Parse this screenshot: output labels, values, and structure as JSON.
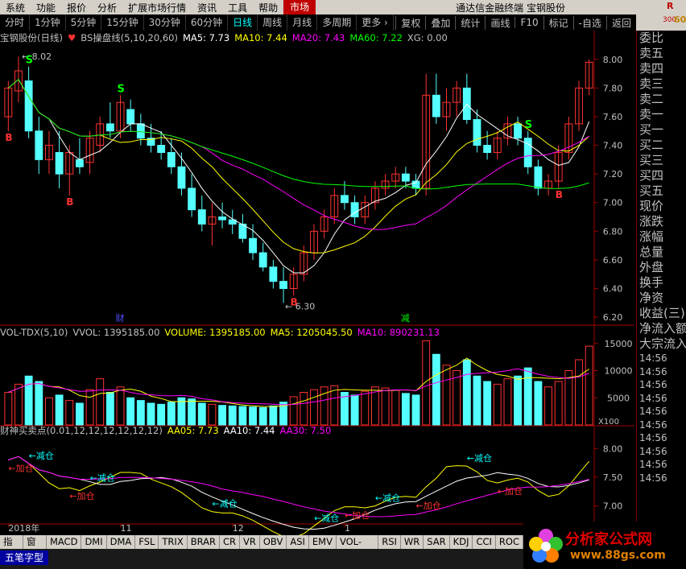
{
  "menu": [
    "系统",
    "功能",
    "报价",
    "分析",
    "扩展市场行情",
    "资讯",
    "工具",
    "帮助"
  ],
  "menu_market": "市场",
  "window_title": "通达信金融终端  宝钢股份",
  "menu_right": [
    "行情"
  ],
  "corner": {
    "r": "R",
    "n": "300",
    "val": "60"
  },
  "toolbar": {
    "periods": [
      "分时",
      "1分钟",
      "5分钟",
      "15分钟",
      "30分钟",
      "60分钟",
      "日线",
      "周线",
      "月线",
      "多周期",
      "更多"
    ],
    "active_period": "日线",
    "more_arrow": "›",
    "right": [
      "复权",
      "叠加",
      "统计",
      "画线",
      "F10",
      "标记",
      "-自选",
      "返回"
    ]
  },
  "price_panel": {
    "stock": "宝钢股份(日线)",
    "indicator": "BS操盘线(5,10,20,60)",
    "ma5": "MA5: 7.73",
    "ma10": "MA10: 7.44",
    "ma20": "MA20: 7.43",
    "ma60": "MA60: 7.22",
    "xg": "XG: 0.00",
    "y_ticks": [
      "8.00",
      "7.80",
      "7.60",
      "7.40",
      "7.20",
      "7.00",
      "6.80",
      "6.60",
      "6.40",
      "6.20"
    ],
    "high_label": "8.02",
    "low_label": "6.30",
    "signals": [
      "S",
      "S",
      "S",
      "B",
      "B",
      "B",
      "B"
    ],
    "events": [
      "财",
      "减"
    ]
  },
  "volume_panel": {
    "title": "VOL-TDX(5,10)",
    "vvol": "VVOL: 1395185.00",
    "volume": "VOLUME: 1395185.00",
    "ma5": "MA5: 1205045.50",
    "ma10": "MA10: 890231.13",
    "y_ticks": [
      "15000",
      "10000",
      "5000"
    ],
    "unit": "X100"
  },
  "ind_panel": {
    "title": "财神买卖点(0.01,12,12,12,12,12,12)",
    "aa05": "AA05: 7.73",
    "aa10": "AA10: 7.44",
    "aa30": "AA30: 7.50",
    "y_ticks": [
      "8.00",
      "7.50",
      "7.00"
    ],
    "labels": [
      "←减仓",
      "←减仓",
      "←减仓",
      "←减仓",
      "←减仓",
      "←减仓",
      "←加仓",
      "←加仓",
      "←加仓",
      "←加仓",
      "←加仓",
      "←加仓"
    ]
  },
  "x_axis": [
    "2018年",
    "11",
    "12",
    "1"
  ],
  "sidebar": {
    "items": [
      "委比",
      "卖五",
      "卖四",
      "卖三",
      "卖二",
      "卖一",
      "买一",
      "买二",
      "买三",
      "买四",
      "买五",
      "现价",
      "涨跌",
      "涨幅",
      "总量",
      "外盘",
      "换手",
      "净资",
      "收益(三)",
      "净流入额",
      "大宗流入"
    ],
    "times": [
      "14:56",
      "14:56",
      "14:56",
      "14:56",
      "14:56",
      "14:56",
      "14:56",
      "14:56",
      "14:56",
      "14:56"
    ]
  },
  "bottom_tabs": [
    "指标",
    "窗口",
    "MACD",
    "DMI",
    "DMA",
    "FSL",
    "TRIX",
    "BRAR",
    "CR",
    "VR",
    "OBV",
    "ASI",
    "EMV",
    "VOL-TDX",
    "RSI",
    "WR",
    "SAR",
    "KDJ",
    "CCI",
    "ROC"
  ],
  "ime": "五笔字型",
  "logo": {
    "text": "分析家公式网",
    "url": "www.88gs.com"
  },
  "colors": {
    "up": "#ff3232",
    "down": "#54ffff",
    "ma5": "#ffffff",
    "ma10": "#ffff00",
    "ma20": "#ff00ff",
    "ma60": "#00ff00"
  },
  "chart_data": {
    "type": "candlestick",
    "title": "BS操盘线(5,10,20,60)",
    "ylim": [
      6.15,
      8.1
    ],
    "candles": [
      [
        7.6,
        7.85,
        7.5,
        7.8
      ],
      [
        7.78,
        8.02,
        7.7,
        7.92
      ],
      [
        7.85,
        7.95,
        7.45,
        7.5
      ],
      [
        7.5,
        7.6,
        7.2,
        7.3
      ],
      [
        7.3,
        7.5,
        7.2,
        7.4
      ],
      [
        7.35,
        7.5,
        7.1,
        7.2
      ],
      [
        7.2,
        7.4,
        7.05,
        7.35
      ],
      [
        7.3,
        7.45,
        7.2,
        7.25
      ],
      [
        7.28,
        7.5,
        7.2,
        7.45
      ],
      [
        7.4,
        7.6,
        7.35,
        7.55
      ],
      [
        7.55,
        7.7,
        7.45,
        7.5
      ],
      [
        7.5,
        7.75,
        7.45,
        7.7
      ],
      [
        7.65,
        7.72,
        7.5,
        7.55
      ],
      [
        7.55,
        7.62,
        7.4,
        7.45
      ],
      [
        7.45,
        7.55,
        7.35,
        7.4
      ],
      [
        7.4,
        7.5,
        7.3,
        7.35
      ],
      [
        7.35,
        7.45,
        7.2,
        7.25
      ],
      [
        7.25,
        7.35,
        7.05,
        7.1
      ],
      [
        7.1,
        7.2,
        6.9,
        6.95
      ],
      [
        6.95,
        7.05,
        6.8,
        6.85
      ],
      [
        6.85,
        7.0,
        6.7,
        6.9
      ],
      [
        6.9,
        7.0,
        6.82,
        6.88
      ],
      [
        6.88,
        6.95,
        6.78,
        6.85
      ],
      [
        6.85,
        6.92,
        6.72,
        6.75
      ],
      [
        6.75,
        6.85,
        6.6,
        6.65
      ],
      [
        6.65,
        6.72,
        6.52,
        6.55
      ],
      [
        6.55,
        6.6,
        6.4,
        6.45
      ],
      [
        6.45,
        6.55,
        6.3,
        6.4
      ],
      [
        6.4,
        6.55,
        6.35,
        6.5
      ],
      [
        6.5,
        6.7,
        6.45,
        6.65
      ],
      [
        6.65,
        6.85,
        6.6,
        6.8
      ],
      [
        6.8,
        6.95,
        6.75,
        6.9
      ],
      [
        6.9,
        7.1,
        6.85,
        7.05
      ],
      [
        7.05,
        7.15,
        6.95,
        7.0
      ],
      [
        7.0,
        7.05,
        6.85,
        6.9
      ],
      [
        6.9,
        7.05,
        6.85,
        7.0
      ],
      [
        7.0,
        7.15,
        6.95,
        7.1
      ],
      [
        7.1,
        7.2,
        7.05,
        7.15
      ],
      [
        7.15,
        7.25,
        7.1,
        7.2
      ],
      [
        7.2,
        7.25,
        7.1,
        7.15
      ],
      [
        7.15,
        7.2,
        7.05,
        7.1
      ],
      [
        7.1,
        7.9,
        7.05,
        7.75
      ],
      [
        7.75,
        7.9,
        7.55,
        7.6
      ],
      [
        7.6,
        7.8,
        7.5,
        7.7
      ],
      [
        7.7,
        7.85,
        7.6,
        7.8
      ],
      [
        7.8,
        7.9,
        7.55,
        7.58
      ],
      [
        7.58,
        7.65,
        7.35,
        7.4
      ],
      [
        7.4,
        7.5,
        7.3,
        7.35
      ],
      [
        7.35,
        7.5,
        7.3,
        7.45
      ],
      [
        7.45,
        7.6,
        7.4,
        7.55
      ],
      [
        7.55,
        7.6,
        7.4,
        7.45
      ],
      [
        7.45,
        7.5,
        7.2,
        7.25
      ],
      [
        7.25,
        7.3,
        7.05,
        7.1
      ],
      [
        7.1,
        7.2,
        7.05,
        7.15
      ],
      [
        7.15,
        7.4,
        7.1,
        7.35
      ],
      [
        7.35,
        7.6,
        7.3,
        7.55
      ],
      [
        7.55,
        7.85,
        7.5,
        7.8
      ],
      [
        7.8,
        8.0,
        7.75,
        7.98
      ]
    ],
    "volumes": [
      6000,
      7500,
      9000,
      8000,
      5000,
      5500,
      4500,
      4000,
      6500,
      8500,
      6000,
      7000,
      5000,
      4500,
      4000,
      3800,
      4200,
      5000,
      4800,
      4000,
      3800,
      3600,
      3500,
      3400,
      3300,
      3200,
      3500,
      4200,
      5200,
      6000,
      6500,
      7000,
      7200,
      6000,
      5500,
      6200,
      7000,
      6800,
      6400,
      5800,
      5500,
      15500,
      13000,
      11000,
      10000,
      12000,
      9000,
      8000,
      7500,
      8500,
      9000,
      10500,
      8000,
      7000,
      8000,
      10000,
      12000,
      14500
    ],
    "volume_ylim": [
      0,
      16000
    ],
    "indicator": {
      "ylim": [
        6.7,
        8.2
      ]
    }
  }
}
